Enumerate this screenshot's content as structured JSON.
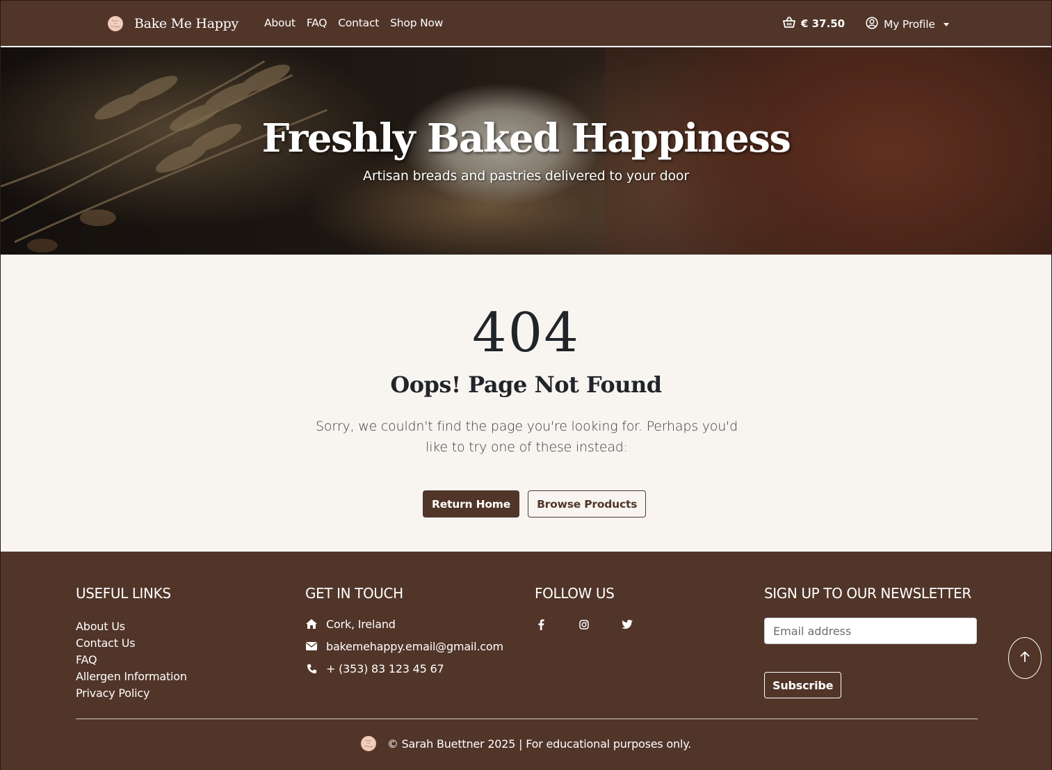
{
  "navbar": {
    "logo_text": "Bake Me Happy",
    "brand": "Bake Me Happy",
    "links": [
      "About",
      "FAQ",
      "Contact",
      "Shop Now"
    ],
    "cart_total": "€ 37.50",
    "profile_label": "My Profile",
    "cart_icon": "basket-icon",
    "profile_icon": "user-circle-icon"
  },
  "hero": {
    "title": "Freshly Baked Happiness",
    "subtitle": "Artisan breads and pastries delivered to your door"
  },
  "error": {
    "code": "404",
    "heading": "Oops! Page Not Found",
    "message": "Sorry, we couldn't find the page you're looking for. Perhaps you'd like to try one of these instead:",
    "primary_button": "Return Home",
    "secondary_button": "Browse Products"
  },
  "footer": {
    "useful_links": {
      "heading": "USEFUL LINKS",
      "items": [
        "About Us",
        "Contact Us",
        "FAQ",
        "Allergen Information",
        "Privacy Policy"
      ]
    },
    "contact": {
      "heading": "GET IN TOUCH",
      "location": "Cork, Ireland",
      "email": "bakemehappy.email@gmail.com",
      "phone": "+ (353) 83 123 45 67"
    },
    "social": {
      "heading": "FOLLOW US",
      "icons": [
        "facebook-icon",
        "instagram-icon",
        "twitter-icon"
      ]
    },
    "newsletter": {
      "heading": "SIGN UP TO OUR NEWSLETTER",
      "placeholder": "Email address",
      "button": "Subscribe"
    },
    "copyright": "© Sarah Buettner 2025 | For educational purposes only."
  },
  "colors": {
    "brand_brown": "#513529",
    "page_bg": "#f8f5f1",
    "text_dark": "#212529"
  }
}
